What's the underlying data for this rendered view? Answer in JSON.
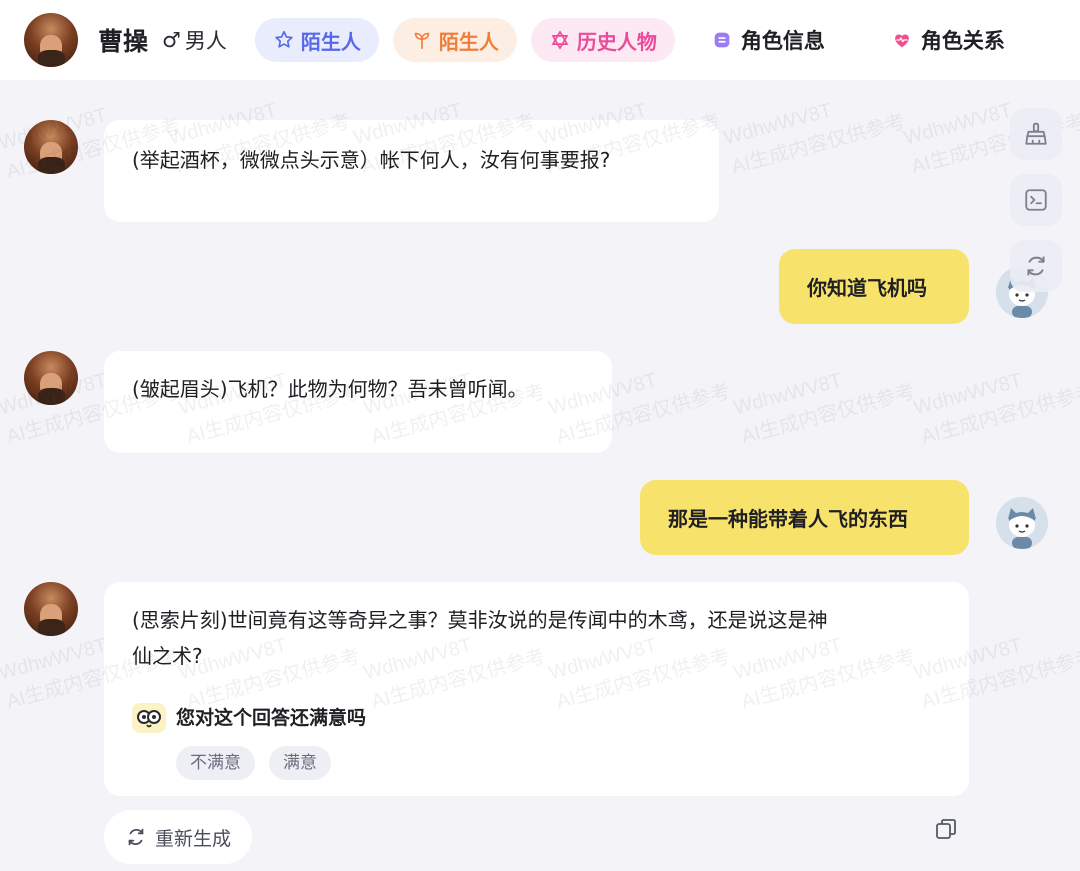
{
  "header": {
    "character_name": "曹操",
    "gender_label": "男人",
    "gender_icon": "male-icon",
    "tags": [
      {
        "label": "陌生人",
        "icon": "star-outline-icon",
        "color": "#5669e8"
      },
      {
        "label": "陌生人",
        "icon": "sprout-icon",
        "color": "#f07d3a"
      },
      {
        "label": "历史人物",
        "icon": "hexagram-icon",
        "color": "#ea4b9a"
      }
    ],
    "links": [
      {
        "label": "角色信息",
        "icon": "document-icon"
      },
      {
        "label": "角色关系",
        "icon": "heart-icon"
      }
    ]
  },
  "watermark": {
    "line1": "WdhwWV8T",
    "line2": "AI生成内容仅供参考"
  },
  "messages": [
    {
      "role": "bot",
      "text": "(举起酒杯，微微点头示意）帐下何人，汝有何事要报?"
    },
    {
      "role": "user",
      "text": "你知道飞机吗"
    },
    {
      "role": "bot",
      "text": "(皱起眉头)飞机？此物为何物？吾未曾听闻。"
    },
    {
      "role": "user",
      "text": "那是一种能带着人飞的东西"
    },
    {
      "role": "bot",
      "text_line1": "(思索片刻)世间竟有这等奇异之事？莫非汝说的是传闻中的木鸢，还是说这是神",
      "text_line2": "仙之术?"
    }
  ],
  "feedback": {
    "question": "您对这个回答还满意吗",
    "options": [
      "不满意",
      "满意"
    ]
  },
  "actions": {
    "regenerate_label": "重新生成",
    "side_buttons": [
      "broom-icon",
      "terminal-icon",
      "refresh-icon"
    ]
  }
}
